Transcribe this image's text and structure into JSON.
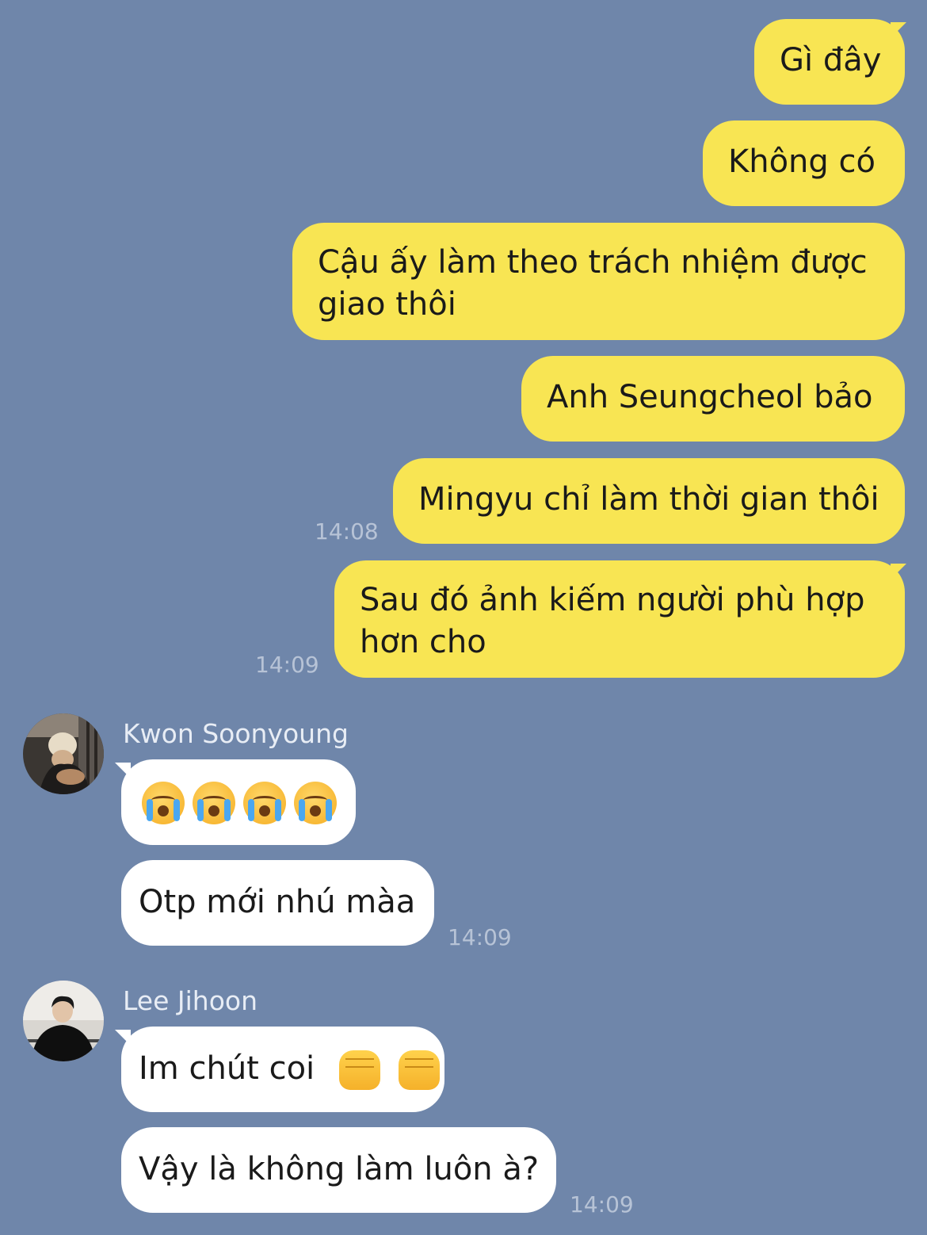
{
  "messages_out": [
    {
      "lines": [
        "Gì đây"
      ]
    },
    {
      "lines": [
        "Không có"
      ]
    },
    {
      "lines": [
        "Cậu ấy làm theo trách nhiệm được",
        "giao thôi"
      ]
    },
    {
      "lines": [
        "Anh Seungcheol bảo"
      ]
    },
    {
      "lines": [
        "Mingyu chỉ làm thời gian thôi"
      ],
      "time": "14:08"
    },
    {
      "lines": [
        "Sau đó ảnh kiếm người phù hợp",
        "hơn cho"
      ],
      "time": "14:09"
    }
  ],
  "group_1": {
    "sender": "Kwon Soonyoung",
    "emoji_msg": {
      "emoji": "crying-face",
      "count": 4
    },
    "msg2": "Otp mới nhú màa",
    "time": "14:09"
  },
  "group_2": {
    "sender": "Lee Jihoon",
    "msg1": "Im chút coi",
    "msg1_emoji": {
      "emoji": "fist",
      "count": 2
    },
    "msg2": "Vậy là không làm luôn à?",
    "time": "14:09"
  },
  "colors": {
    "background": "#6f86aa",
    "outgoing_bubble": "#f8e553",
    "incoming_bubble": "#ffffff",
    "timestamp": "#b7c3d6"
  }
}
